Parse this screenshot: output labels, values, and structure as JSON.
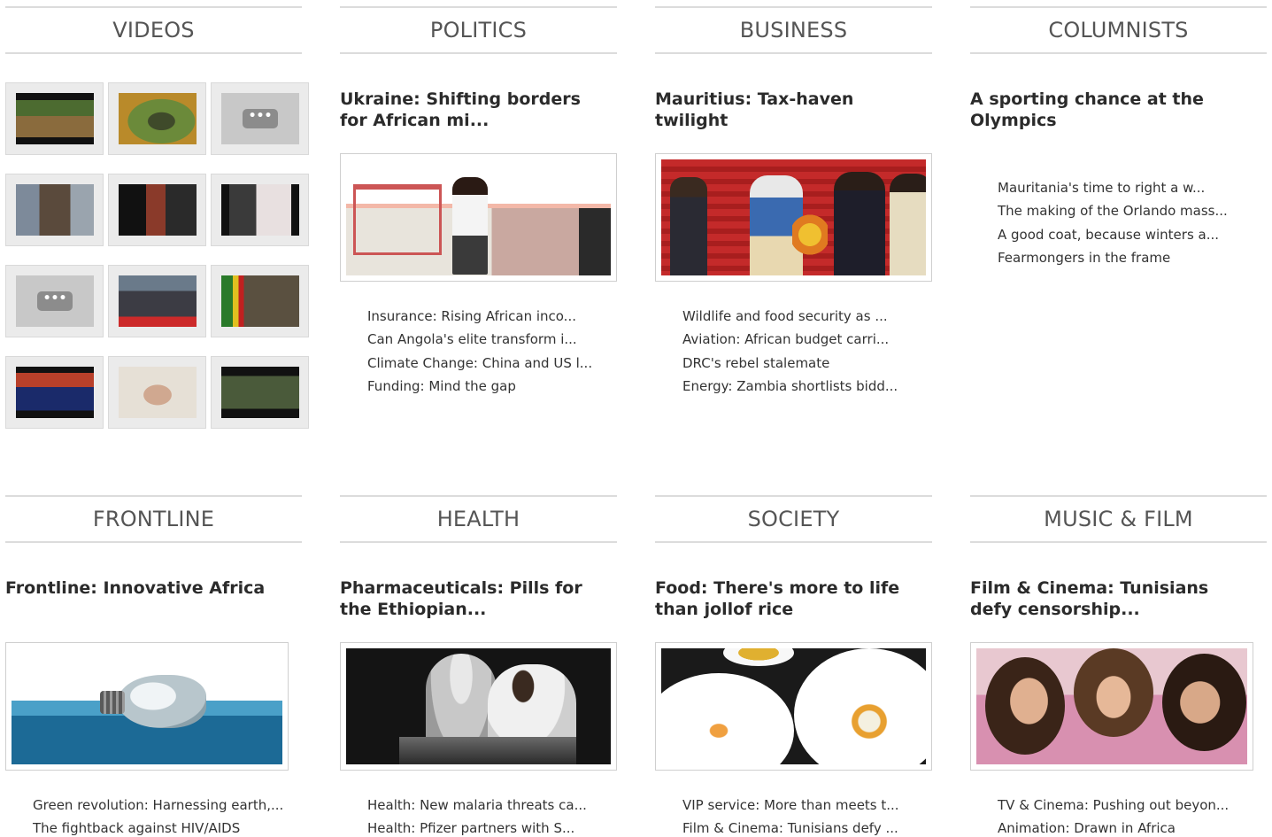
{
  "sections": {
    "videos": {
      "title": "VIDEOS"
    },
    "politics": {
      "title": "POLITICS",
      "headline": "Ukraine: Shifting borders for African mi...",
      "links": [
        "Insurance: Rising African inco...",
        "Can Angola's elite transform i...",
        "Climate Change: China and US l...",
        "Funding: Mind the gap"
      ]
    },
    "business": {
      "title": "BUSINESS",
      "headline": "Mauritius: Tax-haven twilight",
      "links": [
        "Wildlife and food security as ...",
        "Aviation: African budget carri...",
        "DRC's rebel stalemate",
        "Energy: Zambia shortlists bidd..."
      ]
    },
    "columnists": {
      "title": "COLUMNISTS",
      "headline": "A sporting chance at the Olympics",
      "links": [
        "Mauritania's time to right a w...",
        "The making of the Orlando mass...",
        "A good coat, because winters a...",
        "Fearmongers in the frame"
      ]
    },
    "frontline": {
      "title": "FRONTLINE",
      "headline": "Frontline: Innovative Africa",
      "links": [
        "Green revolution: Harnessing earth,...",
        "The fightback against HIV/AIDS"
      ]
    },
    "health": {
      "title": "HEALTH",
      "headline": "Pharmaceuticals: Pills for the Ethiopian...",
      "links": [
        "Health: New malaria threats ca...",
        "Health: Pfizer partners with S..."
      ]
    },
    "society": {
      "title": "SOCIETY",
      "headline": "Food: There's more to life than jollof rice",
      "links": [
        "VIP service: More than meets t...",
        "Film & Cinema: Tunisians defy ..."
      ]
    },
    "music": {
      "title": "MUSIC & FILM",
      "headline": "Film & Cinema: Tunisians defy censorship...",
      "links": [
        "TV & Cinema: Pushing out beyon...",
        "Animation: Drawn in Africa"
      ]
    }
  },
  "video_loading_glyph": "•••",
  "colors": {
    "divider": "#dcdcdc",
    "heading_text": "#555555",
    "headline_text": "#2b2b2b",
    "video_cell_bg": "#ebebeb"
  }
}
